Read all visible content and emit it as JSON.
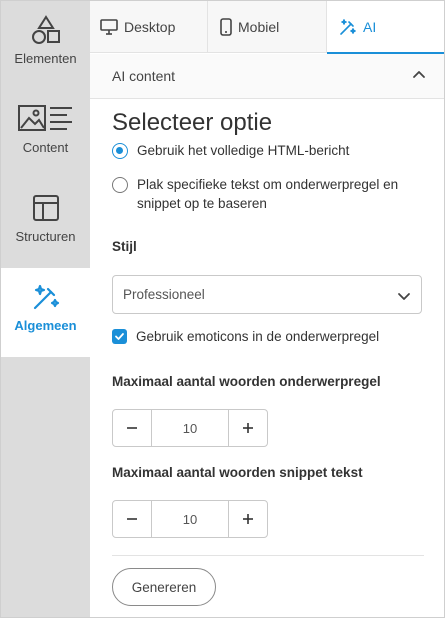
{
  "sidebar": {
    "items": [
      {
        "label": "Elementen",
        "icon": "shapes-icon"
      },
      {
        "label": "Content",
        "icon": "image-text-icon"
      },
      {
        "label": "Structuren",
        "icon": "layout-icon"
      },
      {
        "label": "Algemeen",
        "icon": "magic-wand-icon",
        "active": true
      }
    ]
  },
  "tabs": [
    {
      "label": "Desktop",
      "icon": "desktop-icon"
    },
    {
      "label": "Mobiel",
      "icon": "mobile-icon"
    },
    {
      "label": "AI",
      "icon": "magic-wand-icon",
      "active": true
    }
  ],
  "section": {
    "title": "AI content",
    "heading": "Selecteer optie",
    "radio_options": [
      {
        "label": "Gebruik het volledige HTML-bericht",
        "selected": true
      },
      {
        "label_line1": "Plak specifieke tekst om onderwerpregel en",
        "label_line2": "snippet op te baseren",
        "selected": false
      }
    ],
    "style_label": "Stijl",
    "style_value": "Professioneel",
    "emoticons_label": "Gebruik emoticons in de onderwerpregel",
    "emoticons_checked": true,
    "subject_max_label": "Maximaal aantal woorden onderwerpregel",
    "subject_max_value": "10",
    "snippet_max_label": "Maximaal aantal woorden snippet tekst",
    "snippet_max_value": "10",
    "generate_label": "Genereren"
  },
  "colors": {
    "accent": "#1a8fd8",
    "sidebar_bg": "#dcdcdc"
  }
}
